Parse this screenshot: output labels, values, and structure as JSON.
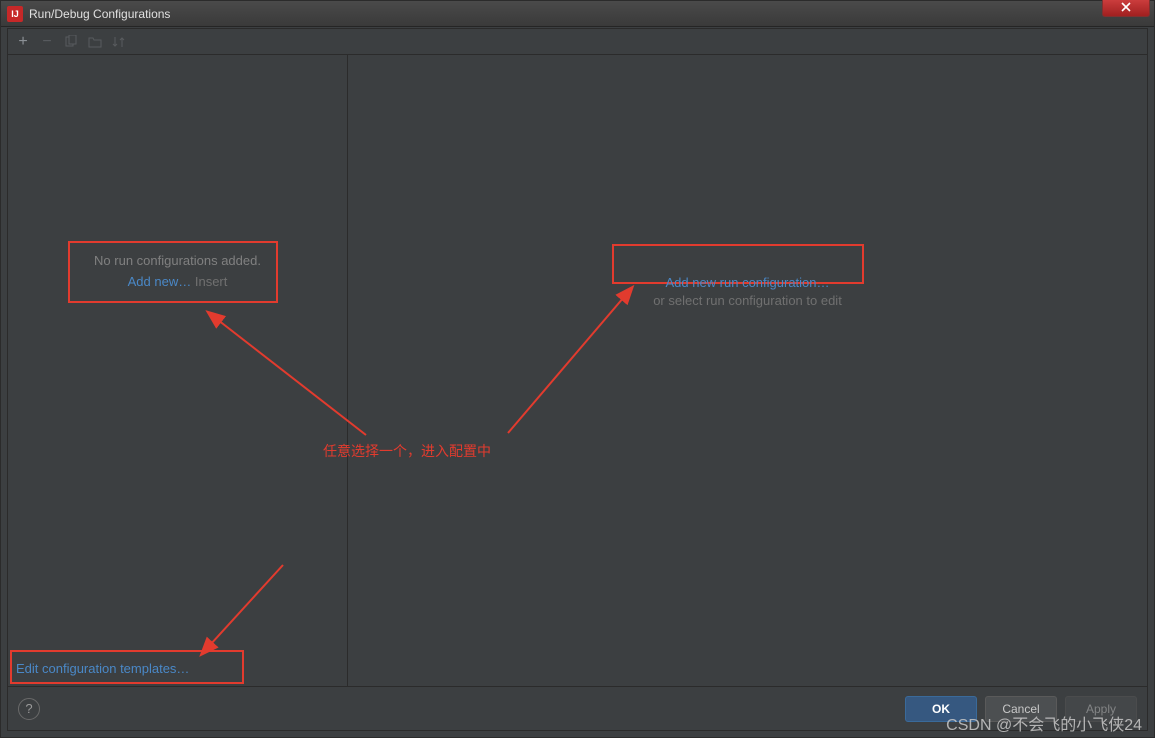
{
  "titlebar": {
    "title": "Run/Debug Configurations",
    "app_icon_label": "IJ"
  },
  "toolbar": {
    "add_tooltip": "Add New Configuration",
    "remove_tooltip": "Remove Configuration",
    "copy_tooltip": "Copy Configuration",
    "folder_tooltip": "Create Folder",
    "sort_tooltip": "Sort"
  },
  "left_panel": {
    "empty_text": "No run configurations added.",
    "add_link": "Add new…",
    "insert_hint": "Insert",
    "templates_link": "Edit configuration templates…"
  },
  "right_panel": {
    "add_link": "Add new run configuration…",
    "hint": "or select run configuration to edit"
  },
  "annotation": {
    "text": "任意选择一个，进入配置中"
  },
  "footer": {
    "help_label": "?",
    "ok": "OK",
    "cancel": "Cancel",
    "apply": "Apply"
  },
  "watermark": "CSDN @不会飞的小飞侠24"
}
